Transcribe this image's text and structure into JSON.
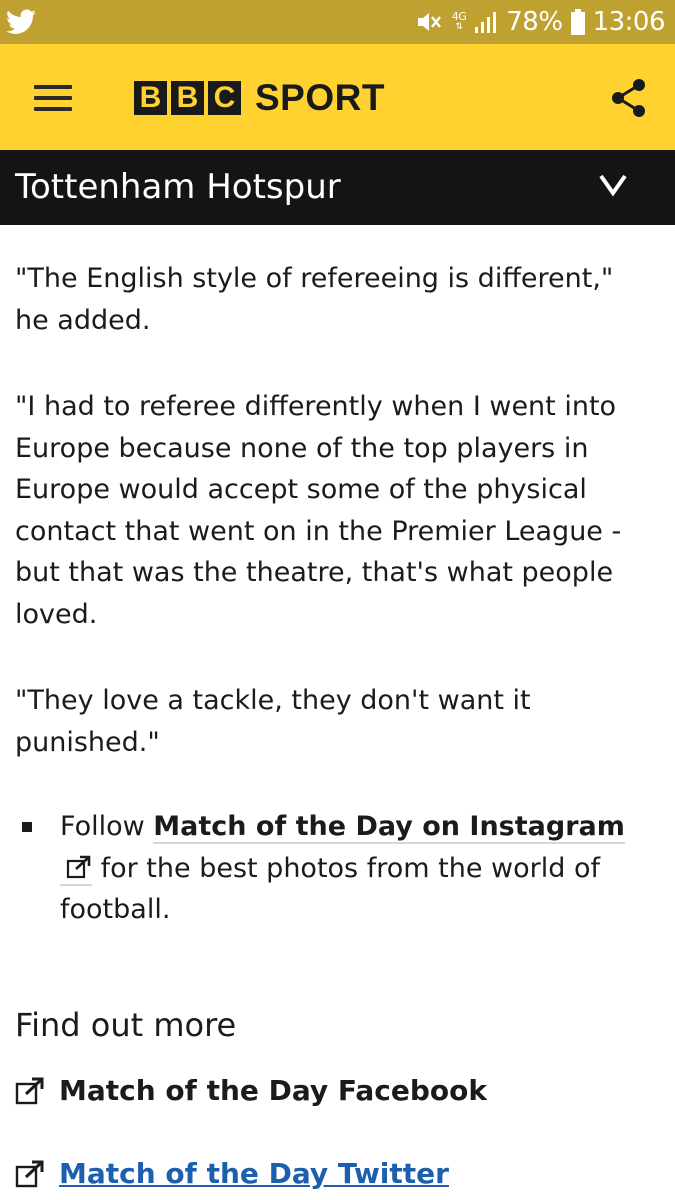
{
  "status_bar": {
    "network": "4G",
    "battery": "78%",
    "time": "13:06",
    "icons": [
      "twitter-icon",
      "mute-icon",
      "signal-icon",
      "battery-icon"
    ]
  },
  "header": {
    "logo_letters": [
      "B",
      "B",
      "C"
    ],
    "logo_word": "SPORT",
    "brand_color": "#ffd230"
  },
  "section": {
    "title": "Tottenham Hotspur"
  },
  "article": {
    "paragraphs": [
      "\"The English style of refereeing is different,\" he added.",
      "\"I had to referee differently when I went into Europe because none of the top players in Europe would accept some of the physical contact that went on in the Premier League - but that was the theatre, that's what people loved.",
      "\"They love a tackle, they don't want it punished.\""
    ],
    "bullet": {
      "prefix": "Follow ",
      "link_text": "Match of the Day on Instagram",
      "suffix": "for the best photos from the world of football."
    }
  },
  "find_out_more": {
    "heading": "Find out more",
    "links": [
      {
        "label": "Match of the Day Facebook"
      },
      {
        "label": "Match of the Day Twitter"
      }
    ]
  },
  "colors": {
    "status_bar": "#bfa132",
    "header": "#ffd230",
    "section_bar": "#141414",
    "link_blue": "#1c5fad"
  }
}
